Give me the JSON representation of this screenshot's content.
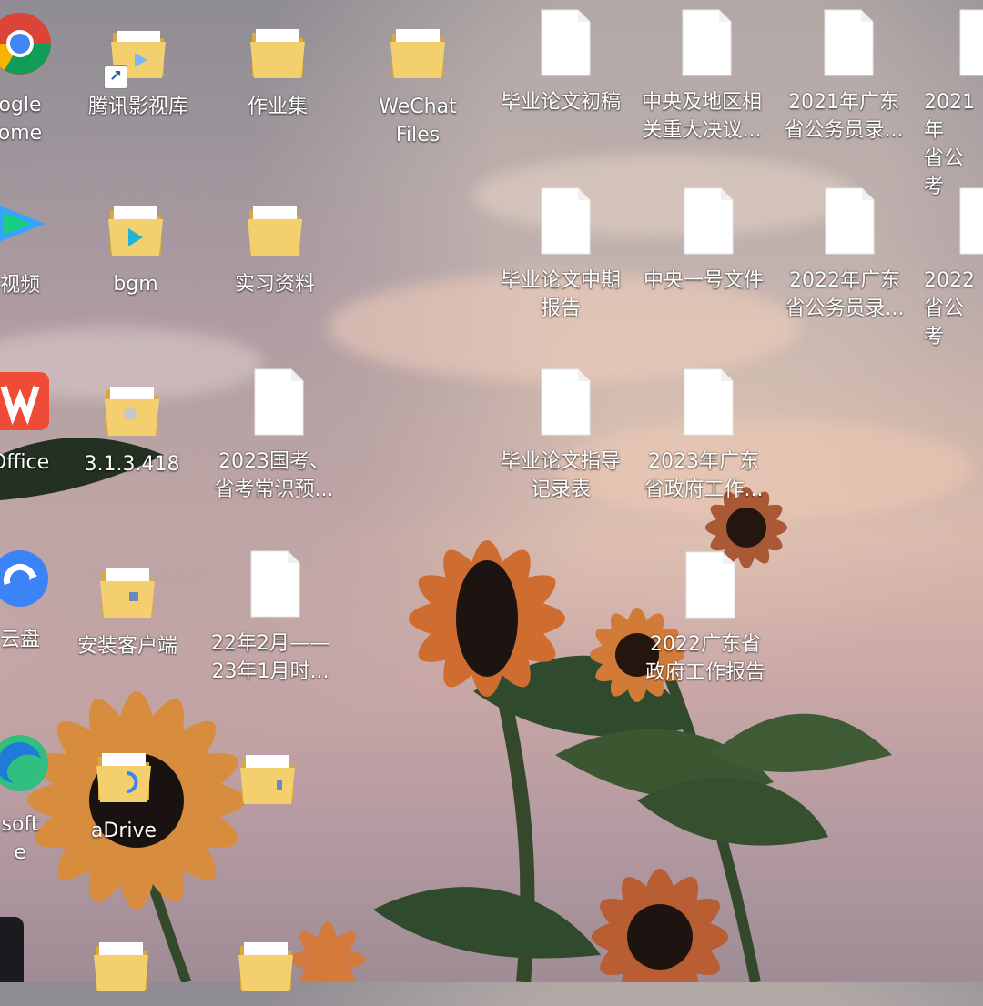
{
  "desktop": {
    "icons": [
      {
        "label": "ogle\nome",
        "type": "chrome"
      },
      {
        "label": "腾讯影视库",
        "type": "folder-shortcut"
      },
      {
        "label": "作业集",
        "type": "folder"
      },
      {
        "label": "WeChat\nFiles",
        "type": "folder"
      },
      {
        "label": "毕业论文初稿",
        "type": "document"
      },
      {
        "label": "中央及地区相\n关重大决议...",
        "type": "document"
      },
      {
        "label": "2021年广东\n省公务员录...",
        "type": "document"
      },
      {
        "label": "2021年\n省公考",
        "type": "document"
      },
      {
        "label": "视频",
        "type": "video-app"
      },
      {
        "label": "bgm",
        "type": "folder"
      },
      {
        "label": "实习资料",
        "type": "folder"
      },
      {
        "label": "毕业论文中期\n报告",
        "type": "document"
      },
      {
        "label": "中央一号文件",
        "type": "document"
      },
      {
        "label": "2022年广东\n省公务员录...",
        "type": "document"
      },
      {
        "label": "2022\n省公考",
        "type": "document"
      },
      {
        "label": "Office",
        "type": "wps"
      },
      {
        "label": "3.1.3.418",
        "type": "folder"
      },
      {
        "label": "2023国考、\n省考常识预...",
        "type": "document"
      },
      {
        "label": "毕业论文指导\n记录表",
        "type": "document"
      },
      {
        "label": "2023年广东\n省政府工作...",
        "type": "document"
      },
      {
        "label": "云盘",
        "type": "cloud-app"
      },
      {
        "label": "安装客户端",
        "type": "folder"
      },
      {
        "label": "22年2月——\n23年1月时...",
        "type": "document"
      },
      {
        "label": "2022广东省\n政府工作报告",
        "type": "document"
      },
      {
        "label": "soft\ne",
        "type": "edge"
      },
      {
        "label": "aDrive",
        "type": "folder"
      },
      {
        "label": "",
        "type": "folder"
      },
      {
        "label": "",
        "type": "folder"
      },
      {
        "label": "",
        "type": "folder"
      }
    ]
  },
  "colors": {
    "folder": "#f3cf6e",
    "folder_dark": "#d9a93d",
    "document": "#ffffff",
    "label": "#ffffff"
  }
}
